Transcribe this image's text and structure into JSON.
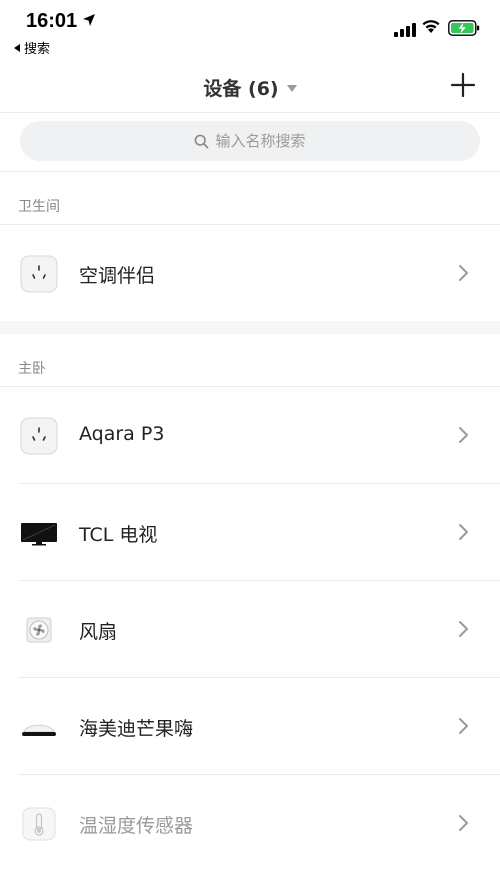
{
  "status": {
    "time": "16:01",
    "back_label": "搜索"
  },
  "nav": {
    "title": "设备 (6)"
  },
  "search": {
    "placeholder": "输入名称搜索"
  },
  "sections": [
    {
      "title": "卫生间",
      "devices": [
        {
          "name": "空调伴侣",
          "icon": "smart-plug-icon"
        }
      ]
    },
    {
      "title": "主卧",
      "devices": [
        {
          "name": "Aqara P3",
          "icon": "smart-plug-icon"
        },
        {
          "name": "TCL 电视",
          "icon": "tv-icon"
        },
        {
          "name": "风扇",
          "icon": "fan-icon"
        },
        {
          "name": "海美迪芒果嗨",
          "icon": "media-box-icon"
        },
        {
          "name": "温湿度传感器",
          "icon": "thermometer-icon"
        }
      ]
    }
  ],
  "colors": {
    "background": "#ffffff",
    "section_gap": "#f5f6f8",
    "divider": "#ececec",
    "muted_text": "#9a9a9a",
    "battery_green": "#34c759"
  }
}
